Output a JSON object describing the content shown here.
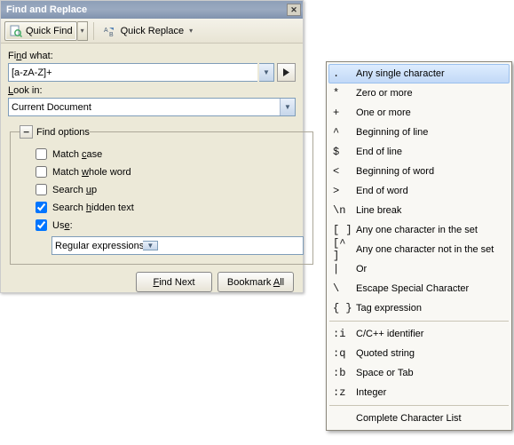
{
  "dialog": {
    "title": "Find and Replace",
    "toolbar": {
      "quick_find": "Quick Find",
      "quick_replace": "Quick Replace"
    },
    "find_what_label": "Find what:",
    "find_what_value": "[a-zA-Z]+",
    "look_in_label": "Look in:",
    "look_in_value": "Current Document",
    "options_legend": "Find options",
    "options": {
      "match_case": {
        "pre": "Match ",
        "mn": "c",
        "post": "ase",
        "checked": false
      },
      "match_whole": {
        "pre": "Match ",
        "mn": "w",
        "post": "hole word",
        "checked": false
      },
      "search_up": {
        "pre": "Search ",
        "mn": "u",
        "post": "p",
        "checked": false
      },
      "search_hidden": {
        "pre": "Search ",
        "mn": "h",
        "post": "idden text",
        "checked": true
      },
      "use": {
        "pre": "Us",
        "mn": "e",
        "post": ":",
        "checked": true
      }
    },
    "use_value": "Regular expressions",
    "buttons": {
      "find_next": {
        "pre": "",
        "mn": "F",
        "post": "ind Next"
      },
      "bookmark_all": {
        "pre": "Bookmark ",
        "mn": "A",
        "post": "ll"
      }
    }
  },
  "menu": {
    "items": [
      {
        "sym": ".",
        "label": "Any single character",
        "hi": true
      },
      {
        "sym": "*",
        "label": "Zero or more"
      },
      {
        "sym": "+",
        "label": "One or more"
      },
      {
        "sym": "^",
        "label": "Beginning of line"
      },
      {
        "sym": "$",
        "label": "End of line"
      },
      {
        "sym": "<",
        "label": "Beginning of word"
      },
      {
        "sym": ">",
        "label": "End of word"
      },
      {
        "sym": "\\n",
        "label": "Line break"
      },
      {
        "sym": "[ ]",
        "label": "Any one character in the set"
      },
      {
        "sym": "[^ ]",
        "label": "Any one character not in the set"
      },
      {
        "sym": "|",
        "label": "Or"
      },
      {
        "sym": "\\",
        "label": "Escape Special Character"
      },
      {
        "sym": "{ }",
        "label": "Tag expression"
      }
    ],
    "items2": [
      {
        "sym": ":i",
        "label": "C/C++ identifier"
      },
      {
        "sym": ":q",
        "label": "Quoted string"
      },
      {
        "sym": ":b",
        "label": "Space or Tab"
      },
      {
        "sym": ":z",
        "label": "Integer"
      }
    ],
    "footer": "Complete Character List"
  }
}
